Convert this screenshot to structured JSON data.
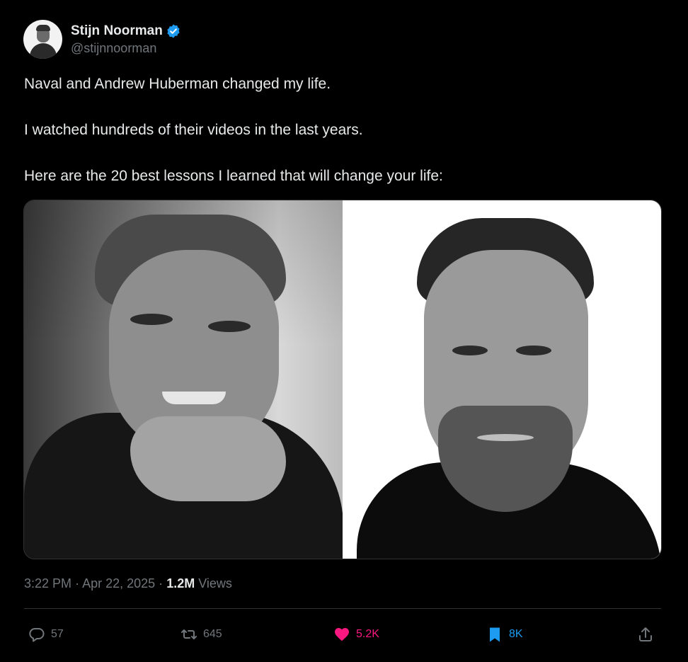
{
  "author": {
    "display_name": "Stijn Noorman",
    "handle": "@stijnnoorman",
    "verified": true
  },
  "tweet": {
    "paragraphs": [
      "Naval and Andrew Huberman changed my life.",
      "I watched hundreds of their videos in the last years.",
      "Here are the 20 best lessons I learned that will change your life:"
    ]
  },
  "meta": {
    "time": "3:22 PM",
    "separator": "·",
    "date": "Apr 22, 2025",
    "views_count": "1.2M",
    "views_label": "Views"
  },
  "actions": {
    "replies": "57",
    "reposts": "645",
    "likes": "5.2K",
    "bookmarks": "8K"
  },
  "colors": {
    "background": "#000000",
    "text": "#e7e9ea",
    "muted": "#71767b",
    "like": "#f91880",
    "bookmark": "#1d9bf0",
    "verified": "#1d9bf0"
  },
  "icons": [
    "verified-badge-icon",
    "reply-icon",
    "repost-icon",
    "like-heart-icon",
    "bookmark-icon",
    "share-icon"
  ]
}
